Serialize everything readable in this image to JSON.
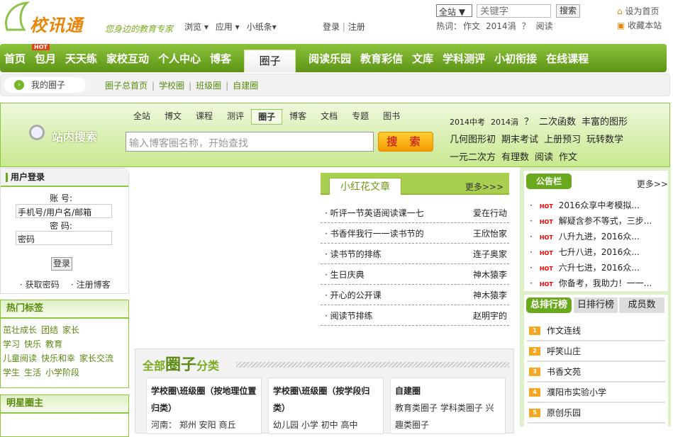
{
  "header": {
    "logo": "校讯通",
    "slogan": "您身边的教育专家",
    "menus": [
      "浏览 ▾",
      "应用 ▾",
      "小纸条▾"
    ],
    "login": "登录",
    "register": "注册",
    "search_scope": "全站 ▼",
    "search_placeholder": "关键字",
    "search_button": "搜索",
    "hot_label": "热词：",
    "hot_words": [
      "作文",
      "2014涓",
      "？",
      "阅读"
    ],
    "set_home": "设为首页",
    "bookmark": "收藏本站"
  },
  "nav": {
    "items": [
      "首页",
      "包月",
      "天天练",
      "家校互动",
      "个人中心",
      "博客",
      "圈子",
      "阅读乐园",
      "教育彩信",
      "文库",
      "学科测评",
      "小初衔接",
      "在线课程"
    ],
    "hot_badge": "HOT",
    "active": "圈子"
  },
  "subnav": {
    "mine": "我的圈子",
    "links": [
      "圈子总首页",
      "学校圈",
      "班级圈",
      "自建圈"
    ]
  },
  "site_search": {
    "title": "站内搜索",
    "tabs": [
      "全站",
      "博文",
      "课程",
      "测评",
      "圈子",
      "博客",
      "文档",
      "专题",
      "图书"
    ],
    "active_tab": "圈子",
    "placeholder": "输入博客圈名称，开始查找",
    "button": "搜 索",
    "hot_words": [
      "2014中考",
      "2014涓",
      "？",
      "二次函数",
      "丰富的图形",
      "几何图形初",
      "期末考试",
      "上册预习",
      "玩转数学",
      "一元二次方",
      "有理数",
      "阅读",
      "作文"
    ]
  },
  "login_box": {
    "title": "用户登录",
    "account_label": "账  号:",
    "account_value": "手机号/用户名/邮箱",
    "password_label": "密  码:",
    "password_value": "密码",
    "login_button": "登录",
    "get_password": "· 获取密码",
    "register_blog": "· 注册博客"
  },
  "hot_tags": {
    "title": "热门标签",
    "tags": [
      "茁壮成长",
      "团结",
      "家长",
      "学习",
      "快乐",
      "教育",
      "儿童阅读",
      "快乐和幸",
      "家长交流",
      "学生",
      "生活",
      "小学阶段"
    ]
  },
  "star_owner": {
    "title": "明星圈主"
  },
  "red_flower": {
    "title": "小红花文章",
    "more": "更多>>>",
    "rows": [
      {
        "title": "· 听评一节英语阅读课一七",
        "author": "爱在行动"
      },
      {
        "title": "· 书香伴我行一一读书节的",
        "author": "王欣怡家"
      },
      {
        "title": "· 读书节的排练",
        "author": "连子奥家"
      },
      {
        "title": "· 生日庆典",
        "author": "神木猿李"
      },
      {
        "title": "· 开心的公开课",
        "author": "神木猿李"
      },
      {
        "title": "· 阅读节排练",
        "author": "赵明宇的"
      }
    ]
  },
  "all_circles": {
    "title_a": "全部",
    "title_b": "圈子",
    "title_c": "分类",
    "cards": [
      {
        "title": "学校圈\\班级圈（按地理位置归类）",
        "body": "河南： 郑州 安阳 商丘"
      },
      {
        "title": "学校圈\\班级圈（按学段归类）",
        "body": "幼儿园 小学 初中 高中"
      },
      {
        "title": "自建圈",
        "body": "教育类圈子 学科类圈子 兴趣类圈子"
      }
    ]
  },
  "notice": {
    "title": "公告栏",
    "more": "更多>>",
    "hot_badge": "HOT",
    "items": [
      "2016众享中考模拟...",
      "解疑含参不等式，三步...",
      "八升九进，2016众...",
      "七升八进，2016众...",
      "六升七进，2016众...",
      "你备考，我助力！一一..."
    ]
  },
  "ranking": {
    "tabs": [
      "总排行榜",
      "日排行榜",
      "成员数"
    ],
    "items": [
      "作文连线",
      "呼笑山庄",
      "书香文苑",
      "濮阳市实验小学",
      "原创乐园"
    ]
  }
}
